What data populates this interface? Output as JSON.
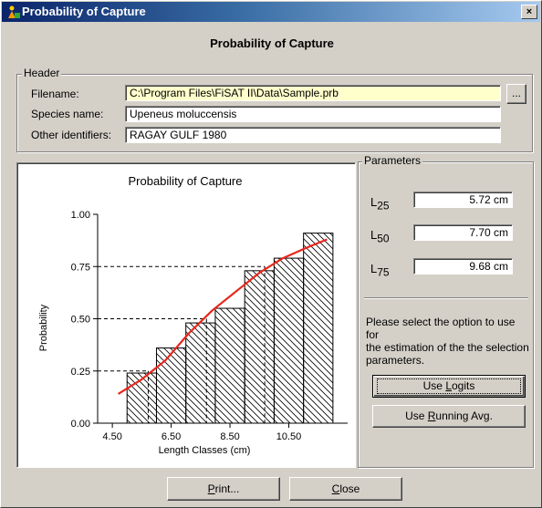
{
  "window": {
    "title": "Probability of Capture",
    "close_glyph": "×"
  },
  "heading": "Probability of Capture",
  "header_group": {
    "legend": "Header",
    "filename_label": "Filename:",
    "filename_value": "C:\\Program Files\\FiSAT II\\Data\\Sample.prb",
    "browse_label": "...",
    "species_label": "Species name:",
    "species_value": "Upeneus moluccensis",
    "other_label": "Other identifiers:",
    "other_value": "RAGAY GULF 1980"
  },
  "parameters": {
    "legend": "Parameters",
    "items": [
      {
        "label": "L",
        "sub": "25",
        "value": "5.72 cm"
      },
      {
        "label": "L",
        "sub": "50",
        "value": "7.70 cm"
      },
      {
        "label": "L",
        "sub": "75",
        "value": "9.68 cm"
      }
    ],
    "info_lines": [
      "Please select the option to use for",
      "the estimation of the the selection",
      "parameters."
    ],
    "logits_label": {
      "pre": "Use ",
      "u": "L",
      "post": "ogits"
    },
    "running_label": {
      "pre": "Use ",
      "u": "R",
      "post": "unning Avg."
    }
  },
  "buttons": {
    "print": {
      "u": "P",
      "post": "rint..."
    },
    "close": {
      "u": "C",
      "post": "lose"
    }
  },
  "colors": {
    "curve": "#e8261c",
    "title_start": "#0a246a",
    "title_end": "#a6caf0",
    "filename_bg": "#ffffcc"
  },
  "chart_data": {
    "type": "bar",
    "title": "Probability of Capture",
    "xlabel": "Length Classes (cm)",
    "ylabel": "Probability",
    "ylim": [
      0,
      1
    ],
    "yticks": [
      "0.00",
      "0.25",
      "0.50",
      "0.75",
      "1.00"
    ],
    "xtick_labels": [
      "4.50",
      "6.50",
      "8.50",
      "10.50"
    ],
    "bars": [
      {
        "from": 5.0,
        "to": 6.0,
        "value": 0.24
      },
      {
        "from": 6.0,
        "to": 7.0,
        "value": 0.36
      },
      {
        "from": 7.0,
        "to": 8.0,
        "value": 0.48
      },
      {
        "from": 8.0,
        "to": 9.0,
        "value": 0.55
      },
      {
        "from": 9.0,
        "to": 10.0,
        "value": 0.73
      },
      {
        "from": 10.0,
        "to": 11.0,
        "value": 0.79
      },
      {
        "from": 11.0,
        "to": 12.0,
        "value": 0.91
      }
    ],
    "curve": [
      {
        "x": 4.7,
        "y": 0.14
      },
      {
        "x": 5.5,
        "y": 0.21
      },
      {
        "x": 6.3,
        "y": 0.3
      },
      {
        "x": 7.1,
        "y": 0.43
      },
      {
        "x": 7.9,
        "y": 0.54
      },
      {
        "x": 8.7,
        "y": 0.63
      },
      {
        "x": 9.5,
        "y": 0.72
      },
      {
        "x": 10.3,
        "y": 0.79
      },
      {
        "x": 11.1,
        "y": 0.84
      },
      {
        "x": 11.8,
        "y": 0.88
      }
    ],
    "reference_lines": [
      {
        "x": 5.72,
        "y": 0.25
      },
      {
        "x": 7.7,
        "y": 0.5
      },
      {
        "x": 9.68,
        "y": 0.75
      }
    ],
    "hatch": true,
    "grid": false
  }
}
